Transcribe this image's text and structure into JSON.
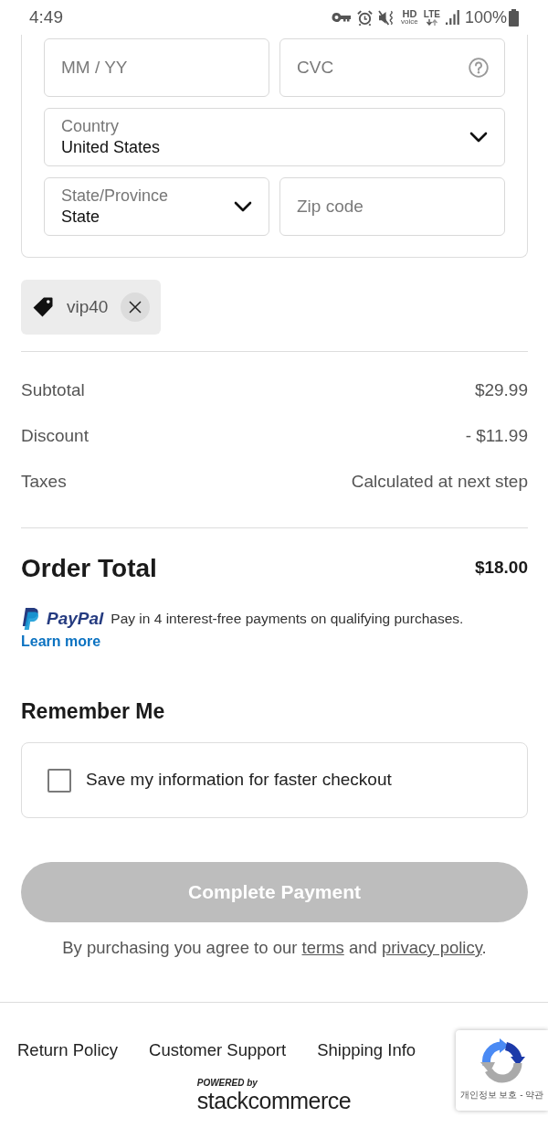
{
  "status_bar": {
    "time": "4:49",
    "hd_label": "HD",
    "hd_sublabel": "voice",
    "network_label": "LTE",
    "battery_text": "100%"
  },
  "payment_form": {
    "expiry": {
      "placeholder": "MM / YY"
    },
    "cvc": {
      "placeholder": "CVC"
    },
    "country": {
      "label": "Country",
      "value": "United States"
    },
    "state": {
      "label": "State/Province",
      "value": "State"
    },
    "zip": {
      "placeholder": "Zip code"
    }
  },
  "coupon": {
    "code": "vip40"
  },
  "summary": {
    "rows": [
      {
        "label": "Subtotal",
        "value": "$29.99"
      },
      {
        "label": "Discount",
        "value": "- $11.99"
      },
      {
        "label": "Taxes",
        "value": "Calculated at next step"
      }
    ],
    "total": {
      "label": "Order Total",
      "value": "$18.00"
    }
  },
  "paypal": {
    "logo_text": "PayPal",
    "message": "Pay in 4 interest-free payments on qualifying purchases.",
    "link": "Learn more"
  },
  "remember_me": {
    "title": "Remember Me",
    "option": {
      "label": "Save my information for faster checkout",
      "checked": false
    }
  },
  "submit": {
    "label": "Complete Payment",
    "disabled": true
  },
  "legal": {
    "parts": [
      {
        "kind": "text",
        "text": "By purchasing you agree to our "
      },
      {
        "kind": "link",
        "text": "terms"
      },
      {
        "kind": "text",
        "text": " and "
      },
      {
        "kind": "link",
        "text": "privacy policy"
      },
      {
        "kind": "text",
        "text": "."
      }
    ]
  },
  "footer": {
    "links": [
      "Return Policy",
      "Customer Support",
      "Shipping Info"
    ],
    "powered_by": "POWERED by",
    "brand": "stackcommerce"
  },
  "captcha_badge": {
    "text": "개인정보 보호 - 약관"
  }
}
